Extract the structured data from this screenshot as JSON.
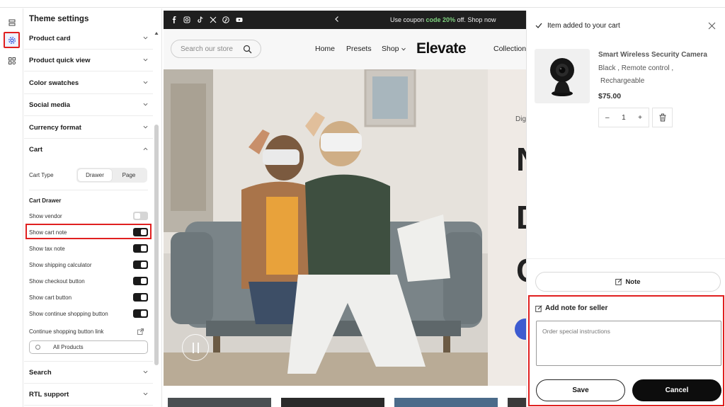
{
  "sidebar": {
    "title": "Theme settings",
    "sections_top": [
      "Product card",
      "Product quick view",
      "Color swatches",
      "Social media",
      "Currency format",
      "Cart"
    ],
    "cart": {
      "cart_type_label": "Cart Type",
      "cart_type_options": [
        "Drawer",
        "Page"
      ],
      "cart_type_selected": "Drawer",
      "cart_drawer_heading": "Cart Drawer",
      "toggles": [
        {
          "label": "Show vendor",
          "on": false
        },
        {
          "label": "Show cart note",
          "on": true
        },
        {
          "label": "Show tax note",
          "on": true
        },
        {
          "label": "Show shipping calculator",
          "on": true
        },
        {
          "label": "Show checkout button",
          "on": true
        },
        {
          "label": "Show cart button",
          "on": true
        },
        {
          "label": "Show continue shopping button",
          "on": true
        }
      ],
      "continue_link_label": "Continue shopping button link",
      "continue_link_value": "All Products"
    },
    "sections_bottom": [
      "Search",
      "RTL support"
    ]
  },
  "preview": {
    "announcement_prefix": "Use coupon ",
    "announcement_code": "code 20%",
    "announcement_suffix": " off. Shop now",
    "search_placeholder": "Search our store",
    "nav": [
      "Home",
      "Presets",
      "Shop",
      "Collection"
    ],
    "logo": "Elevate",
    "hero_snippet": "Dig",
    "hero_letters": [
      "N",
      "D",
      "C"
    ]
  },
  "drawer": {
    "title": "Item added to your cart",
    "product_name": "Smart Wireless Security Camera",
    "variants_line1": "Black ,  Remote control ,",
    "variants_line2": "Rechargeable",
    "price": "$75.00",
    "qty_minus": "–",
    "quantity": "1",
    "qty_plus": "+",
    "note_button": "Note",
    "note_panel_title": "Add note for seller",
    "note_placeholder": "Order special instructions",
    "save_label": "Save",
    "cancel_label": "Cancel"
  },
  "colors": {
    "accent_red": "#e02020",
    "dark": "#0d0d0d",
    "coupon_green": "#7fd27f"
  }
}
